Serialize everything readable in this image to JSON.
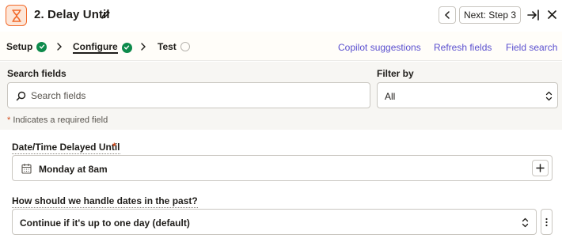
{
  "header": {
    "title": "2. Delay Until",
    "next_label": "Next: Step 3",
    "app_icon": "hourglass-icon",
    "accent_color": "#f26a2a"
  },
  "tabs": [
    {
      "label": "Setup",
      "status": "complete"
    },
    {
      "label": "Configure",
      "status": "complete"
    },
    {
      "label": "Test",
      "status": "pending"
    }
  ],
  "top_links": {
    "copilot": "Copilot suggestions",
    "refresh": "Refresh fields",
    "field_search": "Field search"
  },
  "search": {
    "label": "Search fields",
    "placeholder": "Search fields",
    "value": ""
  },
  "filter": {
    "label": "Filter by",
    "selected": "All"
  },
  "required_note": {
    "star": "*",
    "text": "Indicates a required field"
  },
  "fields": {
    "date_time": {
      "label": "Date/Time Delayed Until",
      "required_mark": "*",
      "value": "Monday at 8am"
    },
    "past_dates": {
      "label": "How should we handle dates in the past?",
      "value": "Continue if it's up to one day (default)"
    }
  },
  "colors": {
    "link": "#5a4fcf",
    "success": "#0d8a4b",
    "required": "#d24a1b"
  }
}
